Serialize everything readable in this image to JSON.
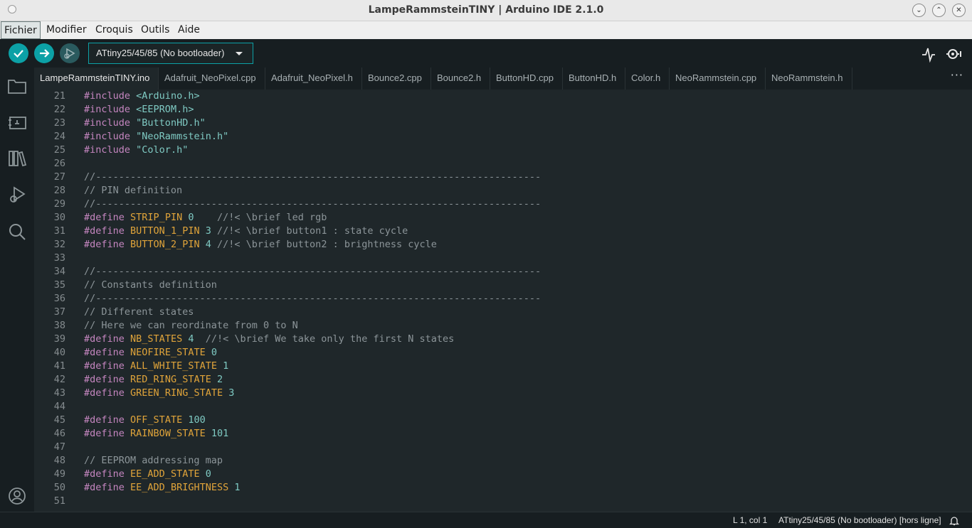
{
  "window": {
    "title": "LampeRammsteinTINY | Arduino IDE 2.1.0"
  },
  "menubar": {
    "items": [
      "Fichier",
      "Modifier",
      "Croquis",
      "Outils",
      "Aide"
    ]
  },
  "toolbar": {
    "verify_icon": "check-icon",
    "upload_icon": "arrow-right-icon",
    "debug_icon": "debug-icon",
    "board": "ATtiny25/45/85 (No bootloader)",
    "serial_plotter_icon": "pulse-icon",
    "serial_monitor_icon": "monitor-icon"
  },
  "sidebar": {
    "icons": [
      "folder-icon",
      "board-manager-icon",
      "library-icon",
      "debug-icon",
      "search-icon",
      "account-icon"
    ]
  },
  "tabs": [
    {
      "label": "LampeRammsteinTINY.ino",
      "active": true
    },
    {
      "label": "Adafruit_NeoPixel.cpp"
    },
    {
      "label": "Adafruit_NeoPixel.h"
    },
    {
      "label": "Bounce2.cpp"
    },
    {
      "label": "Bounce2.h"
    },
    {
      "label": "ButtonHD.cpp"
    },
    {
      "label": "ButtonHD.h"
    },
    {
      "label": "Color.h"
    },
    {
      "label": "NeoRammstein.cpp"
    },
    {
      "label": "NeoRammstein.h"
    }
  ],
  "tabs_more": "···",
  "editor": {
    "lines": [
      {
        "n": "21",
        "t": [
          [
            "kw",
            "#include"
          ],
          [
            "",
            "",
            " "
          ],
          [
            "inc",
            "<Arduino.h>"
          ]
        ]
      },
      {
        "n": "22",
        "t": [
          [
            "kw",
            "#include"
          ],
          [
            "",
            "",
            " "
          ],
          [
            "inc",
            "<EEPROM.h>"
          ]
        ]
      },
      {
        "n": "23",
        "t": [
          [
            "kw",
            "#include"
          ],
          [
            "",
            "",
            " "
          ],
          [
            "inc",
            "\"ButtonHD.h\""
          ]
        ]
      },
      {
        "n": "24",
        "t": [
          [
            "kw",
            "#include"
          ],
          [
            "",
            "",
            " "
          ],
          [
            "inc",
            "\"NeoRammstein.h\""
          ]
        ]
      },
      {
        "n": "25",
        "t": [
          [
            "kw",
            "#include"
          ],
          [
            "",
            "",
            " "
          ],
          [
            "inc",
            "\"Color.h\""
          ]
        ]
      },
      {
        "n": "26",
        "t": []
      },
      {
        "n": "27",
        "t": [
          [
            "cmt",
            "//-----------------------------------------------------------------------------"
          ]
        ]
      },
      {
        "n": "28",
        "t": [
          [
            "cmt",
            "// PIN definition"
          ]
        ]
      },
      {
        "n": "29",
        "t": [
          [
            "cmt",
            "//-----------------------------------------------------------------------------"
          ]
        ]
      },
      {
        "n": "30",
        "t": [
          [
            "kw",
            "#define"
          ],
          [
            "",
            "",
            " "
          ],
          [
            "mac",
            "STRIP_PIN"
          ],
          [
            "",
            "",
            " "
          ],
          [
            "num",
            "0"
          ],
          [
            "",
            "",
            "    "
          ],
          [
            "cmt",
            "//!< \\brief led rgb"
          ]
        ]
      },
      {
        "n": "31",
        "t": [
          [
            "kw",
            "#define"
          ],
          [
            "",
            "",
            " "
          ],
          [
            "mac",
            "BUTTON_1_PIN"
          ],
          [
            "",
            "",
            " "
          ],
          [
            "num",
            "3"
          ],
          [
            "",
            "",
            " "
          ],
          [
            "cmt",
            "//!< \\brief button1 : state cycle"
          ]
        ]
      },
      {
        "n": "32",
        "t": [
          [
            "kw",
            "#define"
          ],
          [
            "",
            "",
            " "
          ],
          [
            "mac",
            "BUTTON_2_PIN"
          ],
          [
            "",
            "",
            " "
          ],
          [
            "num",
            "4"
          ],
          [
            "",
            "",
            " "
          ],
          [
            "cmt",
            "//!< \\brief button2 : brightness cycle"
          ]
        ]
      },
      {
        "n": "33",
        "t": []
      },
      {
        "n": "34",
        "t": [
          [
            "cmt",
            "//-----------------------------------------------------------------------------"
          ]
        ]
      },
      {
        "n": "35",
        "t": [
          [
            "cmt",
            "// Constants definition"
          ]
        ]
      },
      {
        "n": "36",
        "t": [
          [
            "cmt",
            "//-----------------------------------------------------------------------------"
          ]
        ]
      },
      {
        "n": "37",
        "t": [
          [
            "cmt",
            "// Different states"
          ]
        ]
      },
      {
        "n": "38",
        "t": [
          [
            "cmt",
            "// Here we can reordinate from 0 to N"
          ]
        ]
      },
      {
        "n": "39",
        "t": [
          [
            "kw",
            "#define"
          ],
          [
            "",
            "",
            " "
          ],
          [
            "mac",
            "NB_STATES"
          ],
          [
            "",
            "",
            " "
          ],
          [
            "num",
            "4"
          ],
          [
            "",
            "",
            "  "
          ],
          [
            "cmt",
            "//!< \\brief We take only the first N states"
          ]
        ]
      },
      {
        "n": "40",
        "t": [
          [
            "kw",
            "#define"
          ],
          [
            "",
            "",
            " "
          ],
          [
            "mac",
            "NEOFIRE_STATE"
          ],
          [
            "",
            "",
            " "
          ],
          [
            "num",
            "0"
          ]
        ]
      },
      {
        "n": "41",
        "t": [
          [
            "kw",
            "#define"
          ],
          [
            "",
            "",
            " "
          ],
          [
            "mac",
            "ALL_WHITE_STATE"
          ],
          [
            "",
            "",
            " "
          ],
          [
            "num",
            "1"
          ]
        ]
      },
      {
        "n": "42",
        "t": [
          [
            "kw",
            "#define"
          ],
          [
            "",
            "",
            " "
          ],
          [
            "mac",
            "RED_RING_STATE"
          ],
          [
            "",
            "",
            " "
          ],
          [
            "num",
            "2"
          ]
        ]
      },
      {
        "n": "43",
        "t": [
          [
            "kw",
            "#define"
          ],
          [
            "",
            "",
            " "
          ],
          [
            "mac",
            "GREEN_RING_STATE"
          ],
          [
            "",
            "",
            " "
          ],
          [
            "num",
            "3"
          ]
        ]
      },
      {
        "n": "44",
        "t": []
      },
      {
        "n": "45",
        "t": [
          [
            "kw",
            "#define"
          ],
          [
            "",
            "",
            " "
          ],
          [
            "mac",
            "OFF_STATE"
          ],
          [
            "",
            "",
            " "
          ],
          [
            "num",
            "100"
          ]
        ]
      },
      {
        "n": "46",
        "t": [
          [
            "kw",
            "#define"
          ],
          [
            "",
            "",
            " "
          ],
          [
            "mac",
            "RAINBOW_STATE"
          ],
          [
            "",
            "",
            " "
          ],
          [
            "num",
            "101"
          ]
        ]
      },
      {
        "n": "47",
        "t": []
      },
      {
        "n": "48",
        "t": [
          [
            "cmt",
            "// EEPROM addressing map"
          ]
        ]
      },
      {
        "n": "49",
        "t": [
          [
            "kw",
            "#define"
          ],
          [
            "",
            "",
            " "
          ],
          [
            "mac",
            "EE_ADD_STATE"
          ],
          [
            "",
            "",
            " "
          ],
          [
            "num",
            "0"
          ]
        ]
      },
      {
        "n": "50",
        "t": [
          [
            "kw",
            "#define"
          ],
          [
            "",
            "",
            " "
          ],
          [
            "mac",
            "EE_ADD_BRIGHTNESS"
          ],
          [
            "",
            "",
            " "
          ],
          [
            "num",
            "1"
          ]
        ]
      },
      {
        "n": "51",
        "t": []
      }
    ]
  },
  "statusbar": {
    "position": "L 1, col 1",
    "board_status": "ATtiny25/45/85 (No bootloader) [hors ligne]",
    "notifications_icon": "bell-icon"
  },
  "colors": {
    "accent": "#0ca1a6",
    "editor_bg": "#1f272a",
    "chrome_bg": "#171e21",
    "keyword": "#c586c0",
    "macro": "#e0a43a",
    "literal": "#7fcac3",
    "comment": "#8c9599"
  }
}
